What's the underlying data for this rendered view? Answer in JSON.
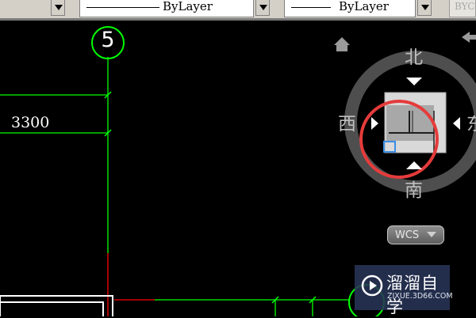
{
  "toolbar": {
    "linetype_combo": {
      "value": "ByLayer"
    },
    "lineweight_combo": {
      "value": "ByLayer"
    },
    "plotstyle_combo": {
      "value": "BYC"
    }
  },
  "drawing": {
    "axis_bubble_label": "5",
    "dimension_text": "3300"
  },
  "viewcube": {
    "north": "北",
    "south": "南",
    "west": "西",
    "east": "东"
  },
  "wcs_menu": {
    "label": "WCS"
  },
  "watermark": {
    "name": "溜溜自学",
    "url": "ZIXUE.3D66.COM"
  },
  "colors": {
    "background": "#000000",
    "grid_line": "#00ff00",
    "red_line": "#ff0000",
    "highlight_circle": "#e53b3b",
    "toolbar": "#d4d0c8"
  }
}
